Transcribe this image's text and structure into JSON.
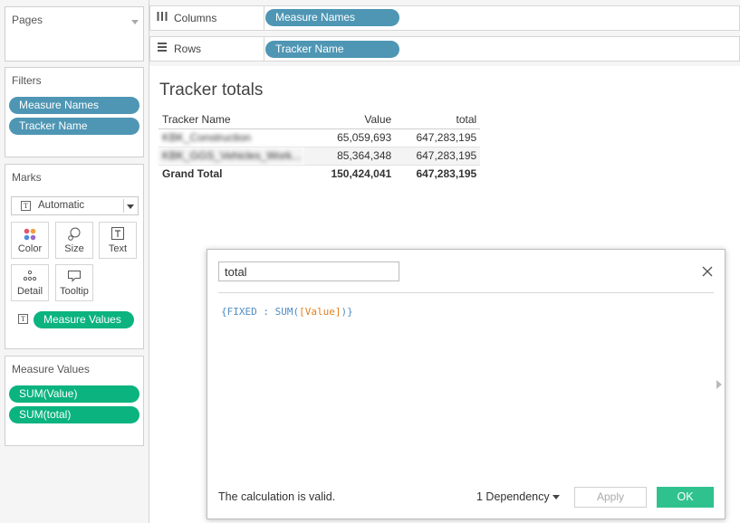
{
  "left_pane": {
    "pages": {
      "title": "Pages"
    },
    "filters": {
      "title": "Filters",
      "pills": [
        "Measure Names",
        "Tracker Name"
      ]
    },
    "marks": {
      "title": "Marks",
      "mark_type": "Automatic",
      "buttons": [
        "Color",
        "Size",
        "Text",
        "Detail",
        "Tooltip"
      ],
      "text_pill": "Measure Values"
    },
    "measure_values": {
      "title": "Measure Values",
      "pills": [
        "SUM(Value)",
        "SUM(total)"
      ]
    }
  },
  "shelves": {
    "columns": {
      "label": "Columns",
      "pill": "Measure Names"
    },
    "rows": {
      "label": "Rows",
      "pill": "Tracker Name"
    }
  },
  "view": {
    "title": "Tracker totals",
    "headers": [
      "Tracker Name",
      "Value",
      "total"
    ],
    "rows": [
      {
        "name": "KBK_Construction",
        "value": "65,059,693",
        "total": "647,283,195"
      },
      {
        "name": "KBK_GGS_Vehicles_Work...",
        "value": "85,364,348",
        "total": "647,283,195"
      }
    ],
    "grand_total": {
      "label": "Grand Total",
      "value": "150,424,041",
      "total": "647,283,195"
    }
  },
  "calc_dialog": {
    "name": "total",
    "formula": {
      "open": "{FIXED : SUM(",
      "field": "[Value]",
      "close": ")}"
    },
    "status": "The calculation is valid.",
    "dependency": "1 Dependency",
    "apply_label": "Apply",
    "ok_label": "OK"
  },
  "colors": {
    "dimension_pill": "#4e96b4",
    "measure_pill": "#0bb37e",
    "ok_button": "#2fc28e"
  }
}
